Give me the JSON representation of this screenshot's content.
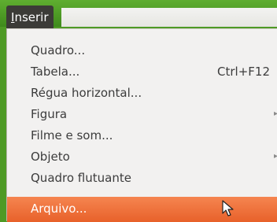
{
  "menubar": {
    "active_menu": "Inserir",
    "active_menu_first": "I",
    "active_menu_rest": "nserir"
  },
  "menu": {
    "items": [
      {
        "label": "Quadro...",
        "shortcut": "",
        "has_submenu": false
      },
      {
        "label": "Tabela...",
        "shortcut": "Ctrl+F12",
        "has_submenu": false
      },
      {
        "label": "Régua horizontal...",
        "shortcut": "",
        "has_submenu": false
      },
      {
        "label": "Figura",
        "shortcut": "",
        "has_submenu": true
      },
      {
        "label": "Filme e som...",
        "shortcut": "",
        "has_submenu": false
      },
      {
        "label": "Objeto",
        "shortcut": "",
        "has_submenu": true
      },
      {
        "label": "Quadro flutuante",
        "shortcut": "",
        "has_submenu": false
      },
      {
        "label": "Arquivo...",
        "shortcut": "",
        "has_submenu": false,
        "highlighted": true
      }
    ]
  },
  "icons": {
    "submenu_arrow": "chevron-right-icon",
    "cursor": "mouse-pointer-icon"
  },
  "colors": {
    "highlight": "#e8612a",
    "menu_background": "#f2f1f0",
    "menubar_active": "#3c3b37",
    "desktop": "#4e9a25"
  }
}
